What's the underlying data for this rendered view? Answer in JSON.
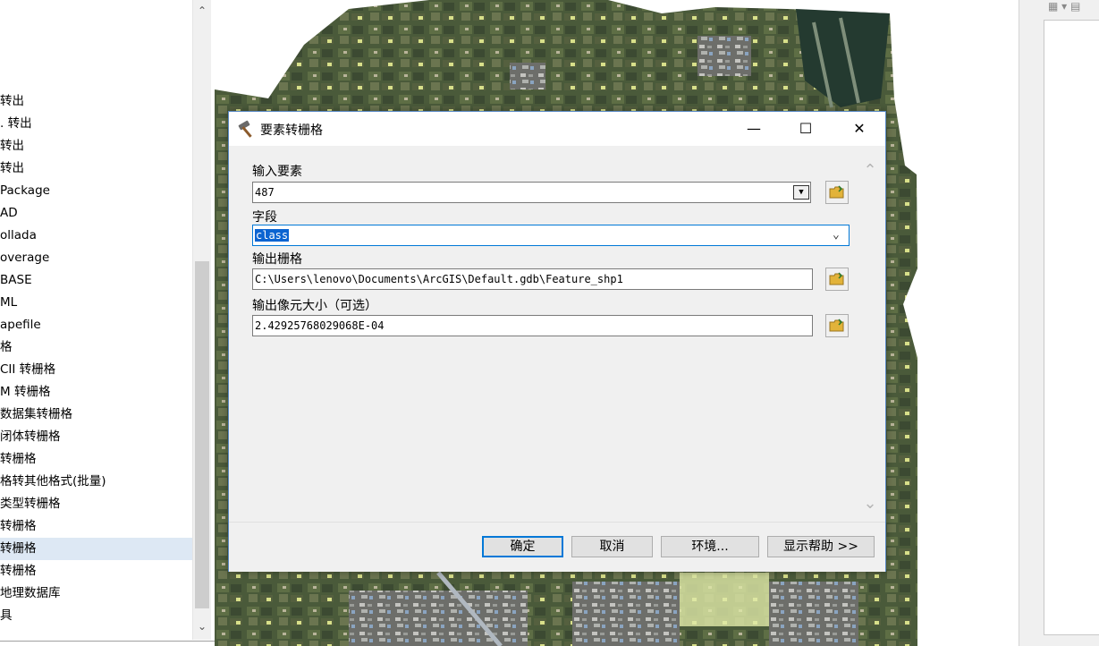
{
  "toolbox": {
    "items": [
      "转出",
      ". 转出",
      "转出",
      "转出",
      "Package",
      "AD",
      "ollada",
      "overage",
      "BASE",
      "ML",
      "apefile",
      "格",
      "CII 转栅格",
      "M 转栅格",
      "数据集转栅格",
      "闭体转栅格",
      "转栅格",
      "格转其他格式(批量)",
      "类型转栅格",
      "转栅格",
      "转栅格",
      "转栅格",
      "地理数据库",
      "具"
    ],
    "selected_index": 20
  },
  "dialog": {
    "title": "要素转栅格",
    "minimize": "—",
    "maximize": "☐",
    "close": "✕",
    "fields": {
      "input_label": "输入要素",
      "input_value": "487",
      "field_label": "字段",
      "field_value": "class",
      "output_label": "输出栅格",
      "output_value": "C:\\Users\\lenovo\\Documents\\ArcGIS\\Default.gdb\\Feature_shp1",
      "cellsize_label": "输出像元大小（可选）",
      "cellsize_value": "2.42925768029068E-04"
    },
    "buttons": {
      "ok": "确定",
      "cancel": "取消",
      "environments": "环境...",
      "show_help": "显示帮助 >>"
    }
  },
  "colors": {
    "accent": "#0078d7",
    "selection": "#0b64d1",
    "dialog_border": "#5a8ac6"
  }
}
